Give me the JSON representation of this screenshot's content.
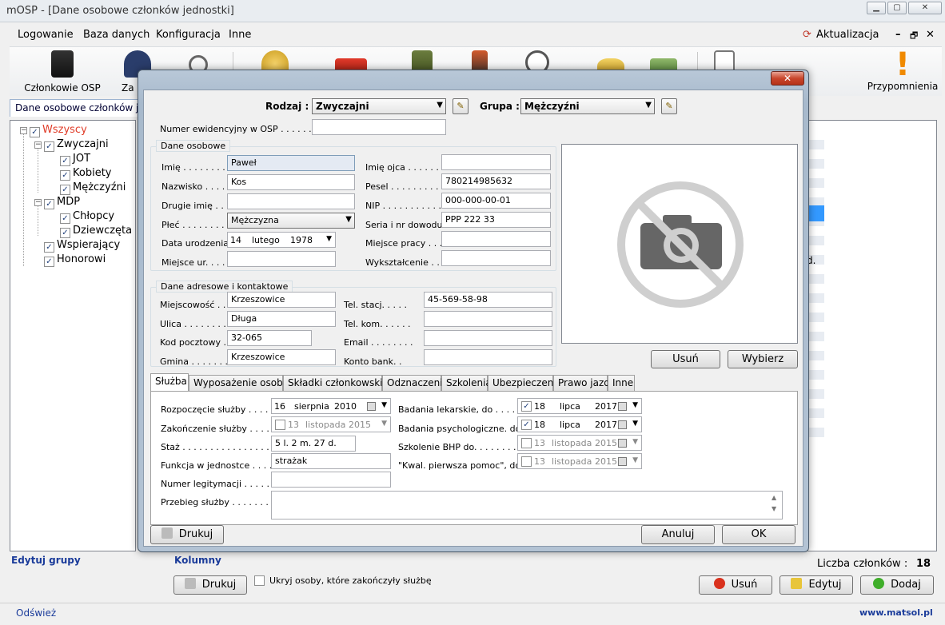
{
  "window": {
    "title": "mOSP - [Dane osobowe członków jednostki]"
  },
  "menu": {
    "items": [
      "Logowanie",
      "Baza danych",
      "Konfiguracja",
      "Inne"
    ],
    "update_label": "Aktualizacja"
  },
  "toolbar": {
    "tools": [
      {
        "label": "Członkowie OSP",
        "icon": "firefighters-icon"
      },
      {
        "label": "Za",
        "icon": "academy-cap-icon"
      },
      {
        "label": "",
        "icon": "stopwatch-icon"
      },
      {
        "label": "",
        "icon": "bell-icon"
      },
      {
        "label": "",
        "icon": "fire-truck-icon"
      },
      {
        "label": "",
        "icon": "fuel-can-icon"
      },
      {
        "label": "",
        "icon": "firefighter-hose-icon"
      },
      {
        "label": "",
        "icon": "gauge-icon"
      },
      {
        "label": "",
        "icon": "coins-icon"
      },
      {
        "label": "",
        "icon": "money-icon"
      },
      {
        "label": "",
        "icon": "clipboard-icon"
      }
    ],
    "reminders_label": "Przypomnienia"
  },
  "doc_tab": {
    "label": "Dane osobowe członków jed"
  },
  "tree": [
    {
      "label": "Wszyscy",
      "checked": true,
      "level": 0,
      "highlight": true
    },
    {
      "label": "Zwyczajni",
      "checked": true,
      "level": 1
    },
    {
      "label": "JOT",
      "checked": true,
      "level": 2
    },
    {
      "label": "Kobiety",
      "checked": true,
      "level": 2
    },
    {
      "label": "Mężczyźni",
      "checked": true,
      "level": 2
    },
    {
      "label": "MDP",
      "checked": true,
      "level": 1
    },
    {
      "label": "Chłopcy",
      "checked": true,
      "level": 2
    },
    {
      "label": "Dziewczęta",
      "checked": true,
      "level": 2
    },
    {
      "label": "Wspierający",
      "checked": true,
      "level": 1
    },
    {
      "label": "Honorowi",
      "checked": true,
      "level": 1
    }
  ],
  "bottom": {
    "edit_groups": "Edytuj grupy",
    "columns": "Kolumny",
    "members_count_label": "Liczba członków :",
    "members_count": "18",
    "print_label": "Drukuj",
    "hide_checkbox_label": "Ukryj osoby, które zakończyły służbę",
    "delete_label": "Usuń",
    "edit_label": "Edytuj",
    "add_label": "Dodaj",
    "refresh": "Odśwież",
    "website": "www.matsol.pl",
    "right_fragment": "d."
  },
  "dialog": {
    "rodzaj_label": "Rodzaj :",
    "rodzaj_value": "Zwyczajni",
    "grupa_label": "Grupa :",
    "grupa_value": "Mężczyźni",
    "numer_label": "Numer ewidencyjny w OSP . . . . . . . .",
    "numer_value": "",
    "personal": {
      "title": "Dane osobowe",
      "imie_label": "Imię . . . . . . . . .",
      "imie": "Paweł",
      "nazwisko_label": "Nazwisko . . . .",
      "nazwisko": "Kos",
      "drugie_label": "Drugie imię . . .",
      "drugie": "",
      "plec_label": "Płeć . . . . . . . .",
      "plec": "Mężczyzna",
      "data_label": "Data urodzenia",
      "data_day": "14",
      "data_month": "lutego",
      "data_year": "1978",
      "miejsce_ur_label": "Miejsce ur. . . . .",
      "miejsce_ur": "",
      "ojca_label": "Imię ojca . . . . . . .",
      "ojca": "",
      "pesel_label": "Pesel . . . . . . . . .",
      "pesel": "780214985632",
      "nip_label": "NIP . . . . . . . . . . .",
      "nip": "000-000-00-01",
      "seria_label": "Seria i nr dowodu .",
      "seria": "PPP 222 33",
      "praca_label": "Miejsce pracy . . .",
      "praca": "",
      "wyk_label": "Wykształcenie . .",
      "wyk": ""
    },
    "address": {
      "title": "Dane adresowe i kontaktowe",
      "miejscowosc_label": "Miejscowość . .",
      "miejscowosc": "Krzeszowice",
      "ulica_label": "Ulica . . . . . . . .",
      "ulica": "Długa",
      "kod_label": "Kod pocztowy .",
      "kod": "32-065",
      "gmina_label": "Gmina . . . . . . .",
      "gmina": "Krzeszowice",
      "tel_stacj_label": "Tel. stacj. . . . .",
      "tel_stacj": "45-569-58-98",
      "tel_kom_label": "Tel. kom. . . . . .",
      "tel_kom": "",
      "email_label": "Email . . . . . . . .",
      "email": "",
      "konto_label": "Konto bank. .",
      "konto": ""
    },
    "photo": {
      "remove_label": "Usuń",
      "choose_label": "Wybierz"
    },
    "tabs": [
      "Służba",
      "Wyposażenie osobiste",
      "Składki członkowskie",
      "Odznaczenia",
      "Szkolenia",
      "Ubezpieczenia",
      "Prawo jazdy",
      "Inne"
    ],
    "service": {
      "rozp_label": "Rozpoczęcie służby . . . . .",
      "rozp": {
        "day": "16",
        "month": "sierpnia",
        "year": "2010"
      },
      "zak_label": "Zakończenie służby . . . . .",
      "zak": {
        "day": "13",
        "month": "listopada",
        "year": "2015",
        "checked": false
      },
      "staz_label": "Staż . . . . . . . . . . . . . . . .",
      "staz": "5 l. 2 m. 27 d.",
      "funkcja_label": "Funkcja w jednostce . . . . .",
      "funkcja": "strażak",
      "legit_label": "Numer legitymacji . . . . . . .",
      "legit": "",
      "przebieg_label": "Przebieg służby . . . . . . . .",
      "przebieg": "",
      "lek_label": "Badania lekarskie, do . . . . .",
      "lek": {
        "day": "18",
        "month": "lipca",
        "year": "2017",
        "checked": true
      },
      "psych_label": "Badania psychologiczne. do",
      "psych": {
        "day": "18",
        "month": "lipca",
        "year": "2017",
        "checked": true
      },
      "bhp_label": "Szkolenie BHP do. . . . . . . .",
      "bhp": {
        "day": "13",
        "month": "listopada",
        "year": "2015",
        "checked": false
      },
      "kpp_label": "\"Kwal. pierwsza pomoc\", do",
      "kpp": {
        "day": "13",
        "month": "listopada",
        "year": "2015",
        "checked": false
      }
    },
    "print_label": "Drukuj",
    "cancel_label": "Anuluj",
    "ok_label": "OK"
  }
}
